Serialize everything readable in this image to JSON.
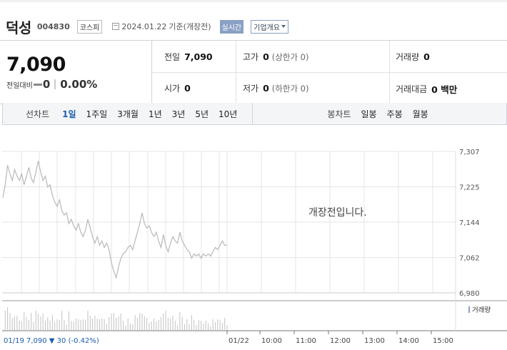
{
  "stock": {
    "name": "덕성",
    "code": "004830",
    "market": "코스피",
    "date": "2024.01.22",
    "basis": "기준(개장전)",
    "realtime_badge": "실시간",
    "overview_button": "기업개요"
  },
  "summary": {
    "current_price": "7,090",
    "change_label": "전일대비",
    "change_value": "0",
    "change_percent": "0.00%",
    "prev_close_label": "전일",
    "prev_close": "7,090",
    "high_label": "고가",
    "high": "0",
    "upper_limit": "(상한가 0)",
    "volume_label": "거래량",
    "volume": "0",
    "open_label": "시가",
    "open": "0",
    "low_label": "저가",
    "low": "0",
    "lower_limit": "(하한가 0)",
    "amount_label": "거래대금",
    "amount": "0 백만"
  },
  "tabs": {
    "line_chart_label": "선차트",
    "line_chart_periods": [
      "1일",
      "1주일",
      "3개월",
      "1년",
      "3년",
      "5년",
      "10년"
    ],
    "active_period": "1일",
    "candle_label": "봉차트",
    "candle_periods": [
      "일봉",
      "주봉",
      "월봉"
    ]
  },
  "chart": {
    "message": "개장전입니다.",
    "volume_legend": "거래량",
    "bottom_info": "01/19  7,090 ▼ 30 (-0.42%)",
    "colors": {
      "line": "#b8b8b8",
      "grid": "#e6e6e6",
      "axis": "#999999",
      "info": "#1a5cb0"
    }
  },
  "chart_data": {
    "type": "line",
    "title": "",
    "xlabel": "",
    "ylabel": "",
    "ylim": [
      6980,
      7307
    ],
    "y_ticks": [
      "7,307",
      "7,225",
      "7,144",
      "7,062",
      "6,980"
    ],
    "x_ticks": [
      "01/19",
      "01/22",
      "10:00",
      "11:00",
      "12:00",
      "13:00",
      "14:00",
      "15:00"
    ],
    "grid": true,
    "previous_session": {
      "date": "01/19",
      "prices": [
        7200,
        7230,
        7275,
        7255,
        7240,
        7265,
        7250,
        7240,
        7255,
        7230,
        7250,
        7270,
        7245,
        7235,
        7260,
        7285,
        7260,
        7240,
        7250,
        7225,
        7230,
        7205,
        7190,
        7180,
        7195,
        7170,
        7160,
        7165,
        7140,
        7150,
        7135,
        7125,
        7140,
        7120,
        7110,
        7125,
        7150,
        7130,
        7110,
        7095,
        7110,
        7090,
        7100,
        7085,
        7095,
        7080,
        7050,
        7030,
        7015,
        7040,
        7060,
        7070,
        7075,
        7085,
        7090,
        7080,
        7100,
        7120,
        7140,
        7165,
        7140,
        7130,
        7135,
        7120,
        7110,
        7120,
        7100,
        7085,
        7115,
        7090,
        7075,
        7095,
        7110,
        7100,
        7095,
        7120,
        7100,
        7090,
        7080,
        7075,
        7060,
        7070,
        7065,
        7070,
        7060,
        7070,
        7065,
        7070,
        7065,
        7075,
        7085,
        7080,
        7090,
        7100,
        7090,
        7090
      ]
    },
    "current_session": {
      "date": "01/22",
      "prices": []
    }
  }
}
